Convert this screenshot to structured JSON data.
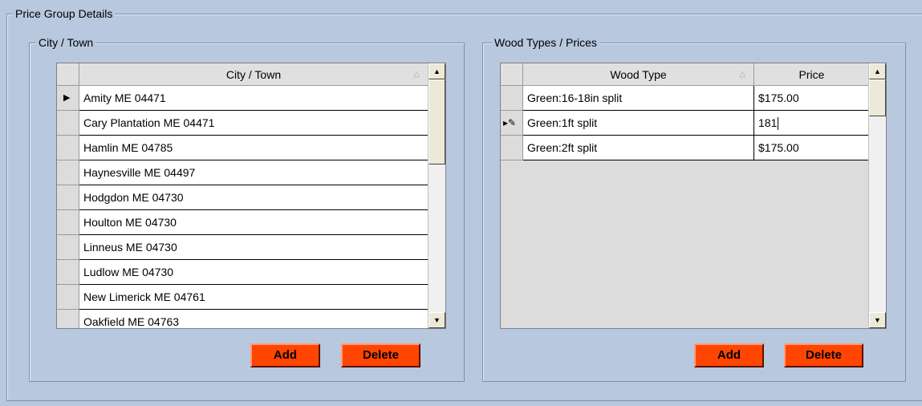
{
  "outer_group": {
    "legend": "Price Group Details"
  },
  "city_group": {
    "legend": "City / Town",
    "column_header": "City / Town",
    "rows": [
      "Amity ME 04471",
      "Cary Plantation ME 04471",
      "Hamlin ME 04785",
      "Haynesville ME 04497",
      "Hodgdon ME 04730",
      "Houlton ME 04730",
      "Linneus ME 04730",
      "Ludlow ME 04730",
      "New Limerick ME 04761",
      "Oakfield ME 04763"
    ],
    "add_label": "Add",
    "delete_label": "Delete"
  },
  "wood_group": {
    "legend": "Wood Types / Prices",
    "column_wood": "Wood Type",
    "column_price": "Price",
    "rows": [
      {
        "wood": "Green:16-18in split",
        "price": "$175.00"
      },
      {
        "wood": "Green:1ft split",
        "price": "181"
      },
      {
        "wood": "Green:2ft split",
        "price": "$175.00"
      }
    ],
    "add_label": "Add",
    "delete_label": "Delete"
  },
  "colors": {
    "button": "#ff4500",
    "background": "#b8c8de"
  }
}
